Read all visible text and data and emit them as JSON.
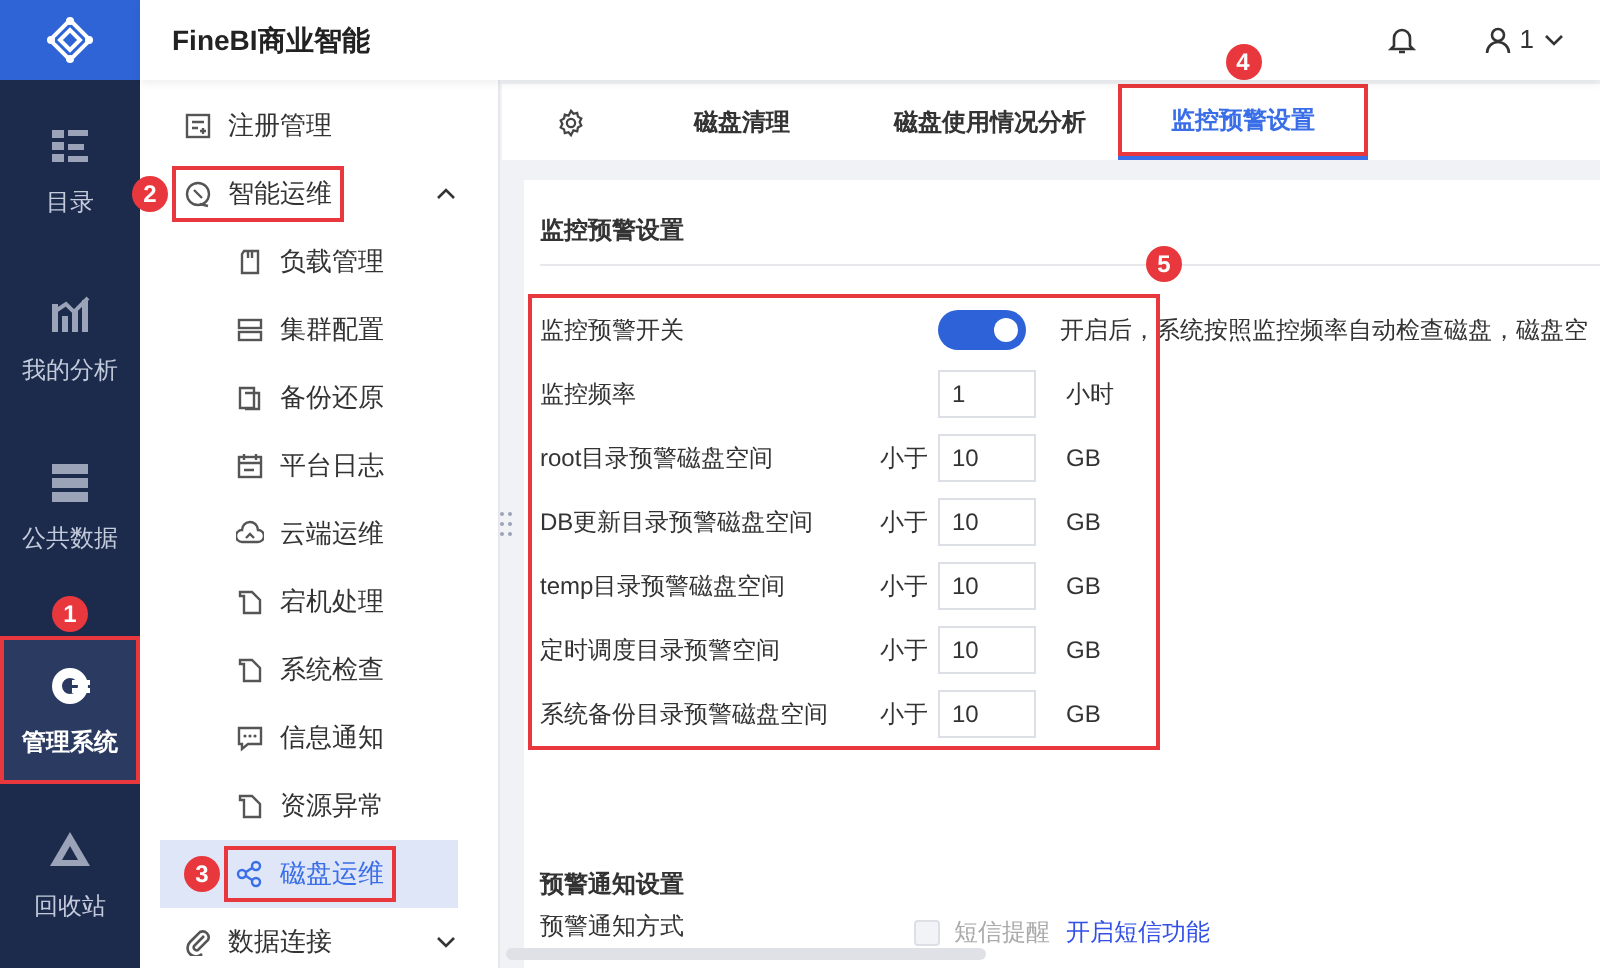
{
  "app": {
    "title": "FineBI商业智能"
  },
  "header": {
    "user": "1"
  },
  "rail": [
    {
      "kind": "catalog",
      "label": "目录",
      "selected": false
    },
    {
      "kind": "analysis",
      "label": "我的分析",
      "selected": false
    },
    {
      "kind": "public",
      "label": "公共数据",
      "selected": false
    },
    {
      "kind": "manage",
      "label": "管理系统",
      "selected": true,
      "callout": "1"
    },
    {
      "kind": "recycle",
      "label": "回收站",
      "selected": false
    }
  ],
  "menu": [
    {
      "kind": "register",
      "label": "注册管理"
    },
    {
      "kind": "ops",
      "label": "智能运维",
      "expanded": true,
      "callout": "2",
      "children": [
        {
          "kind": "load",
          "label": "负载管理",
          "selected": false
        },
        {
          "kind": "cluster",
          "label": "集群配置",
          "selected": false
        },
        {
          "kind": "backup",
          "label": "备份还原",
          "selected": false
        },
        {
          "kind": "log",
          "label": "平台日志",
          "selected": false
        },
        {
          "kind": "cloud",
          "label": "云端运维",
          "selected": false
        },
        {
          "kind": "doc",
          "label": "宕机处理",
          "selected": false
        },
        {
          "kind": "doc",
          "label": "系统检查",
          "selected": false
        },
        {
          "kind": "notice",
          "label": "信息通知",
          "selected": false
        },
        {
          "kind": "doc",
          "label": "资源异常",
          "selected": false
        },
        {
          "kind": "disk",
          "label": "磁盘运维",
          "selected": true,
          "callout": "3"
        }
      ]
    },
    {
      "kind": "connect",
      "label": "数据连接",
      "expanded": false
    }
  ],
  "tabs": [
    {
      "kind": "settings",
      "selected": false
    },
    {
      "kind": "text",
      "label": "磁盘清理",
      "selected": false
    },
    {
      "kind": "text",
      "label": "磁盘使用情况分析",
      "selected": false
    },
    {
      "kind": "text",
      "label": "监控预警设置",
      "selected": true,
      "callout": "4"
    }
  ],
  "panel": {
    "title": "监控预警设置",
    "callout": "5",
    "rows": [
      {
        "kind": "switch",
        "label": "监控预警开关",
        "on": true,
        "note": "开启后，系统按照监控频率自动检查磁盘，磁盘空"
      },
      {
        "kind": "number",
        "label": "监控频率",
        "value": "1",
        "unit": "小时"
      },
      {
        "kind": "threshold",
        "label": "root目录预警磁盘空间",
        "prefix": "小于",
        "value": "10",
        "unit": "GB"
      },
      {
        "kind": "threshold",
        "label": "DB更新目录预警磁盘空间",
        "prefix": "小于",
        "value": "10",
        "unit": "GB"
      },
      {
        "kind": "threshold",
        "label": "temp目录预警磁盘空间",
        "prefix": "小于",
        "value": "10",
        "unit": "GB"
      },
      {
        "kind": "threshold",
        "label": "定时调度目录预警空间",
        "prefix": "小于",
        "value": "10",
        "unit": "GB"
      },
      {
        "kind": "threshold",
        "label": "系统备份目录预警磁盘空间",
        "prefix": "小于",
        "value": "10",
        "unit": "GB"
      }
    ]
  },
  "notify": {
    "title": "预警通知设置",
    "label": "预警通知方式",
    "option": {
      "label": "短信提醒",
      "checked": false,
      "disabled": true
    },
    "link": "开启短信功能"
  }
}
